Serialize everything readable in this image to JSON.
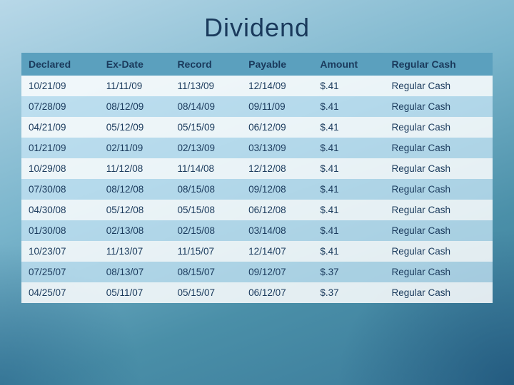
{
  "title": "Dividend",
  "table": {
    "headers": [
      "Declared",
      "Ex-Date",
      "Record",
      "Payable",
      "Amount",
      "Regular Cash"
    ],
    "rows": [
      [
        "10/21/09",
        "11/11/09",
        "11/13/09",
        "12/14/09",
        "$.41",
        "Regular Cash"
      ],
      [
        "07/28/09",
        "08/12/09",
        "08/14/09",
        "09/11/09",
        "$.41",
        "Regular Cash"
      ],
      [
        "04/21/09",
        "05/12/09",
        "05/15/09",
        "06/12/09",
        "$.41",
        "Regular Cash"
      ],
      [
        "01/21/09",
        "02/11/09",
        "02/13/09",
        "03/13/09",
        "$.41",
        "Regular Cash"
      ],
      [
        "10/29/08",
        "11/12/08",
        "11/14/08",
        "12/12/08",
        "$.41",
        "Regular Cash"
      ],
      [
        "07/30/08",
        "08/12/08",
        "08/15/08",
        "09/12/08",
        "$.41",
        "Regular Cash"
      ],
      [
        "04/30/08",
        "05/12/08",
        "05/15/08",
        "06/12/08",
        "$.41",
        "Regular Cash"
      ],
      [
        "01/30/08",
        "02/13/08",
        "02/15/08",
        "03/14/08",
        "$.41",
        "Regular Cash"
      ],
      [
        "10/23/07",
        "11/13/07",
        "11/15/07",
        "12/14/07",
        "$.41",
        "Regular Cash"
      ],
      [
        "07/25/07",
        "08/13/07",
        "08/15/07",
        "09/12/07",
        "$.37",
        "Regular Cash"
      ],
      [
        "04/25/07",
        "05/11/07",
        "05/15/07",
        "06/12/07",
        "$.37",
        "Regular Cash"
      ]
    ]
  }
}
